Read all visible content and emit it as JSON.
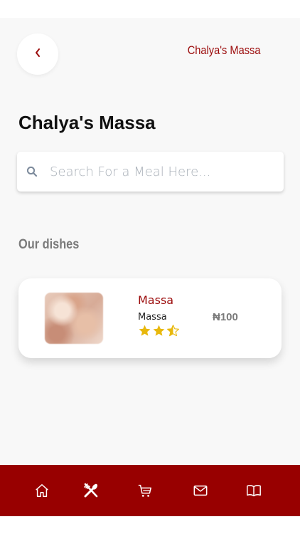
{
  "header": {
    "title": "Chalya's Massa",
    "back_icon": "chevron-left-icon"
  },
  "page": {
    "title": "Chalya's Massa"
  },
  "search": {
    "placeholder": "Search For a Meal Here...",
    "value": "",
    "icon": "search-icon"
  },
  "section": {
    "title": "Our dishes"
  },
  "dishes": [
    {
      "name": "Massa",
      "subtitle": "Massa",
      "price": "₦100",
      "rating": 2.5,
      "rating_max": 3
    }
  ],
  "bottom_nav": {
    "items": [
      {
        "icon": "home-icon"
      },
      {
        "icon": "restaurant-icon"
      },
      {
        "icon": "cart-icon"
      },
      {
        "icon": "mail-icon"
      },
      {
        "icon": "book-icon"
      }
    ]
  },
  "colors": {
    "accent": "#980000",
    "title_accent": "#9b0a0a",
    "background": "#f8f8f8",
    "star": "#e8b80c",
    "muted_text": "#7a7a7a"
  }
}
